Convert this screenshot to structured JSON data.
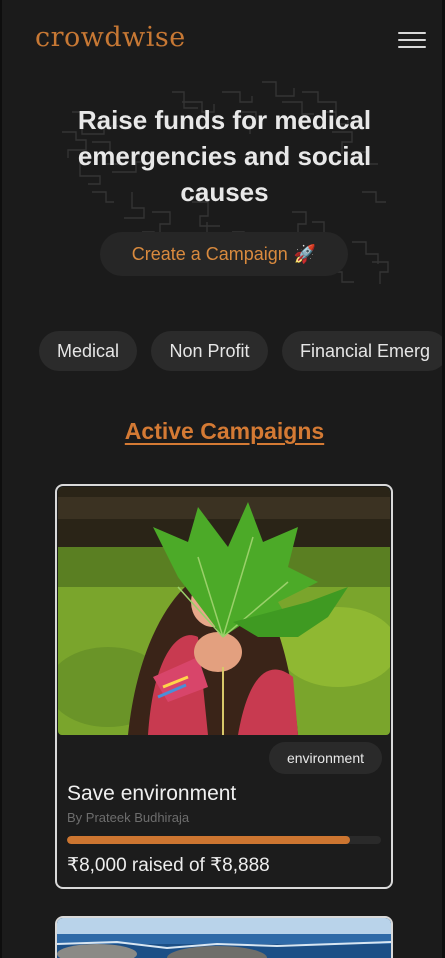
{
  "brand": {
    "logo": "crowdwise"
  },
  "hero": {
    "title": "Raise funds for medical emergencies and social causes",
    "cta_label": "Create a Campaign",
    "cta_icon": "🚀"
  },
  "categories": [
    "Medical",
    "Non Profit",
    "Financial Emerg"
  ],
  "section_title": "Active Campaigns",
  "campaigns": [
    {
      "tag": "environment",
      "title": "Save environment",
      "author": "By Prateek Budhiraja",
      "raised_text": "₹8,000 raised of ₹8,888",
      "progress": 0.9
    }
  ],
  "colors": {
    "accent": "#cc7530",
    "background": "#1b1b1b"
  }
}
